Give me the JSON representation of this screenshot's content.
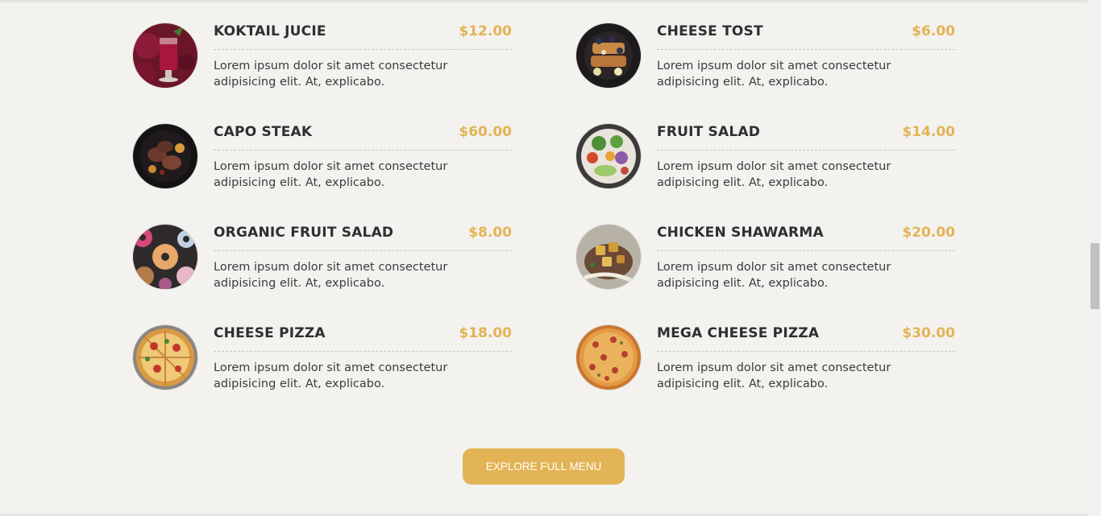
{
  "menu": {
    "items": [
      {
        "name": "KOKTAIL JUCIE",
        "price": "$12.00",
        "description": "Lorem ipsum dolor sit amet consectetur adipisicing elit. At, explicabo."
      },
      {
        "name": "CHEESE TOST",
        "price": "$6.00",
        "description": "Lorem ipsum dolor sit amet consectetur adipisicing elit. At, explicabo."
      },
      {
        "name": "CAPO STEAK",
        "price": "$60.00",
        "description": "Lorem ipsum dolor sit amet consectetur adipisicing elit. At, explicabo."
      },
      {
        "name": "FRUIT SALAD",
        "price": "$14.00",
        "description": "Lorem ipsum dolor sit amet consectetur adipisicing elit. At, explicabo."
      },
      {
        "name": "ORGANIC FRUIT SALAD",
        "price": "$8.00",
        "description": "Lorem ipsum dolor sit amet consectetur adipisicing elit. At, explicabo."
      },
      {
        "name": "CHICKEN SHAWARMA",
        "price": "$20.00",
        "description": "Lorem ipsum dolor sit amet consectetur adipisicing elit. At, explicabo."
      },
      {
        "name": "CHEESE PIZZA",
        "price": "$18.00",
        "description": "Lorem ipsum dolor sit amet consectetur adipisicing elit. At, explicabo."
      },
      {
        "name": "MEGA CHEESE PIZZA",
        "price": "$30.00",
        "description": "Lorem ipsum dolor sit amet consectetur adipisicing elit. At, explicabo."
      }
    ]
  },
  "explore_button": {
    "label": "EXPLORE FULL MENU"
  },
  "colors": {
    "accent": "#e2b455",
    "background": "#f4f2ee",
    "text": "#2f2e33"
  }
}
